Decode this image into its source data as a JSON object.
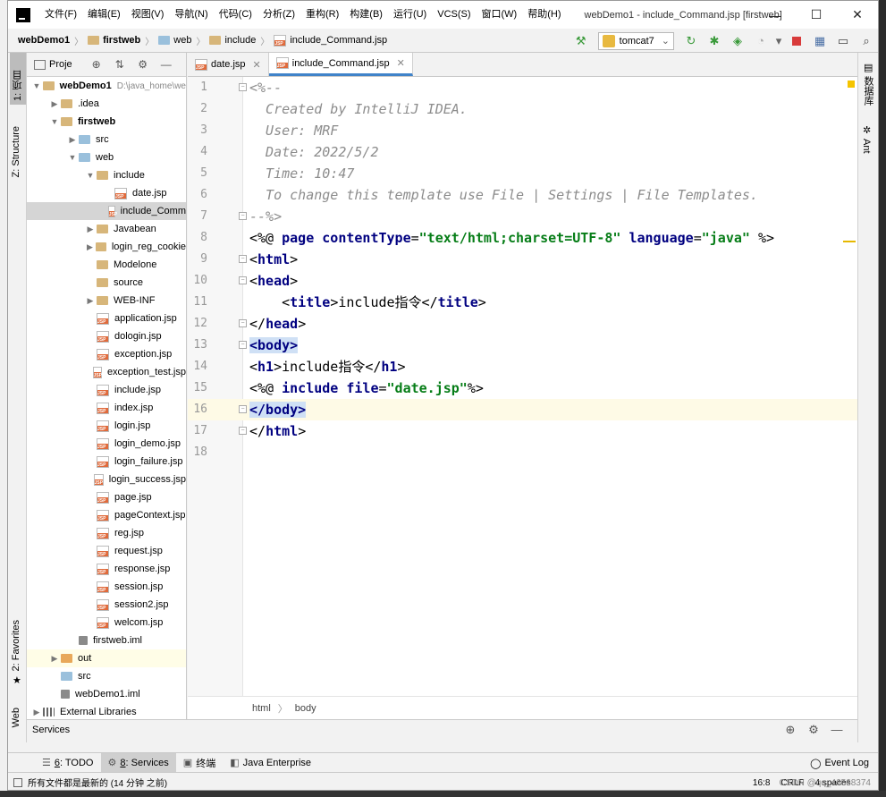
{
  "window": {
    "title": "webDemo1 - include_Command.jsp [firstweb]",
    "minimize": "—",
    "maximize": "☐",
    "close": "✕"
  },
  "menu": [
    "文件(F)",
    "编辑(E)",
    "视图(V)",
    "导航(N)",
    "代码(C)",
    "分析(Z)",
    "重构(R)",
    "构建(B)",
    "运行(U)",
    "VCS(S)",
    "窗口(W)",
    "帮助(H)"
  ],
  "breadcrumb": [
    "webDemo1",
    "firstweb",
    "web",
    "include",
    "include_Command.jsp"
  ],
  "run_config": {
    "label": "tomcat7"
  },
  "left_tabs": {
    "project": "1: 项目",
    "structure": "Z: Structure",
    "favorites": "2: Favorites",
    "web": "Web"
  },
  "right_tabs": {
    "database": "数据库",
    "ant": "Ant"
  },
  "project_panel": {
    "title": "Proje",
    "tree": [
      {
        "label": "webDemo1",
        "hint": "D:\\java_home\\we",
        "type": "folder",
        "depth": 0,
        "expanded": true,
        "bold": true
      },
      {
        "label": ".idea",
        "type": "folder",
        "depth": 1,
        "expanded": false
      },
      {
        "label": "firstweb",
        "type": "folder",
        "depth": 1,
        "expanded": true,
        "bold": true
      },
      {
        "label": "src",
        "type": "folder-blue",
        "depth": 2,
        "expanded": false
      },
      {
        "label": "web",
        "type": "folder-blue",
        "depth": 2,
        "expanded": true
      },
      {
        "label": "include",
        "type": "folder",
        "depth": 3,
        "expanded": true
      },
      {
        "label": "date.jsp",
        "type": "jsp",
        "depth": 4
      },
      {
        "label": "include_Comm",
        "type": "jsp",
        "depth": 4,
        "selected": true
      },
      {
        "label": "Javabean",
        "type": "folder",
        "depth": 3,
        "expanded": false
      },
      {
        "label": "login_reg_cookie",
        "type": "folder",
        "depth": 3,
        "expanded": false
      },
      {
        "label": "Modelone",
        "type": "folder",
        "depth": 3
      },
      {
        "label": "source",
        "type": "folder",
        "depth": 3
      },
      {
        "label": "WEB-INF",
        "type": "folder",
        "depth": 3,
        "expanded": false
      },
      {
        "label": "application.jsp",
        "type": "jsp",
        "depth": 3
      },
      {
        "label": "dologin.jsp",
        "type": "jsp",
        "depth": 3
      },
      {
        "label": "exception.jsp",
        "type": "jsp",
        "depth": 3
      },
      {
        "label": "exception_test.jsp",
        "type": "jsp",
        "depth": 3
      },
      {
        "label": "include.jsp",
        "type": "jsp",
        "depth": 3
      },
      {
        "label": "index.jsp",
        "type": "jsp",
        "depth": 3
      },
      {
        "label": "login.jsp",
        "type": "jsp",
        "depth": 3
      },
      {
        "label": "login_demo.jsp",
        "type": "jsp",
        "depth": 3
      },
      {
        "label": "login_failure.jsp",
        "type": "jsp",
        "depth": 3
      },
      {
        "label": "login_success.jsp",
        "type": "jsp",
        "depth": 3
      },
      {
        "label": "page.jsp",
        "type": "jsp",
        "depth": 3
      },
      {
        "label": "pageContext.jsp",
        "type": "jsp",
        "depth": 3
      },
      {
        "label": "reg.jsp",
        "type": "jsp",
        "depth": 3
      },
      {
        "label": "request.jsp",
        "type": "jsp",
        "depth": 3
      },
      {
        "label": "response.jsp",
        "type": "jsp",
        "depth": 3
      },
      {
        "label": "session.jsp",
        "type": "jsp",
        "depth": 3
      },
      {
        "label": "session2.jsp",
        "type": "jsp",
        "depth": 3
      },
      {
        "label": "welcom.jsp",
        "type": "jsp",
        "depth": 3
      },
      {
        "label": "firstweb.iml",
        "type": "iml",
        "depth": 2
      },
      {
        "label": "out",
        "type": "folder-orange",
        "depth": 1,
        "expanded": false,
        "highlight": true
      },
      {
        "label": "src",
        "type": "folder-blue",
        "depth": 1
      },
      {
        "label": "webDemo1.iml",
        "type": "iml",
        "depth": 1
      },
      {
        "label": "External Libraries",
        "type": "lib",
        "depth": 0,
        "expanded": false
      }
    ]
  },
  "editor": {
    "tabs": [
      {
        "label": "date.jsp",
        "active": false
      },
      {
        "label": "include_Command.jsp",
        "active": true
      }
    ],
    "current_line": 16,
    "lines": [
      [
        {
          "t": "<%--",
          "c": "comment"
        }
      ],
      [
        {
          "t": "  Created by IntelliJ IDEA.",
          "c": "comment"
        }
      ],
      [
        {
          "t": "  User: MRF",
          "c": "comment"
        }
      ],
      [
        {
          "t": "  Date: 2022/5/2",
          "c": "comment"
        }
      ],
      [
        {
          "t": "  Time: 10:47",
          "c": "comment"
        }
      ],
      [
        {
          "t": "  To change this template use File | Settings | File Templates.",
          "c": "comment"
        }
      ],
      [
        {
          "t": "--%>",
          "c": "comment"
        }
      ],
      [
        {
          "t": "<%@ ",
          "c": ""
        },
        {
          "t": "page ",
          "c": "kw"
        },
        {
          "t": "contentType",
          "c": "kw"
        },
        {
          "t": "=",
          "c": ""
        },
        {
          "t": "\"text/html;charset=UTF-8\"",
          "c": "str"
        },
        {
          "t": " ",
          "c": ""
        },
        {
          "t": "language",
          "c": "kw"
        },
        {
          "t": "=",
          "c": ""
        },
        {
          "t": "\"java\"",
          "c": "str"
        },
        {
          "t": " %>",
          "c": ""
        }
      ],
      [
        {
          "t": "<",
          "c": ""
        },
        {
          "t": "html",
          "c": "tag"
        },
        {
          "t": ">",
          "c": ""
        }
      ],
      [
        {
          "t": "<",
          "c": ""
        },
        {
          "t": "head",
          "c": "tag"
        },
        {
          "t": ">",
          "c": ""
        }
      ],
      [
        {
          "t": "    <",
          "c": ""
        },
        {
          "t": "title",
          "c": "tag"
        },
        {
          "t": ">include指令</",
          "c": ""
        },
        {
          "t": "title",
          "c": "tag"
        },
        {
          "t": ">",
          "c": ""
        }
      ],
      [
        {
          "t": "</",
          "c": ""
        },
        {
          "t": "head",
          "c": "tag"
        },
        {
          "t": ">",
          "c": ""
        }
      ],
      [
        {
          "t": "<body>",
          "c": "tag hl"
        }
      ],
      [
        {
          "t": "<",
          "c": ""
        },
        {
          "t": "h1",
          "c": "tag"
        },
        {
          "t": ">include指令</",
          "c": ""
        },
        {
          "t": "h1",
          "c": "tag"
        },
        {
          "t": ">",
          "c": ""
        }
      ],
      [
        {
          "t": "<%@ ",
          "c": ""
        },
        {
          "t": "include ",
          "c": "kw"
        },
        {
          "t": "file",
          "c": "kw"
        },
        {
          "t": "=",
          "c": ""
        },
        {
          "t": "\"date.jsp\"",
          "c": "str"
        },
        {
          "t": "%>",
          "c": ""
        }
      ],
      [
        {
          "t": "</body>",
          "c": "tag hl"
        }
      ],
      [
        {
          "t": "</",
          "c": ""
        },
        {
          "t": "html",
          "c": "tag"
        },
        {
          "t": ">",
          "c": ""
        }
      ],
      [
        {
          "t": "",
          "c": ""
        }
      ]
    ],
    "fold_lines": [
      1,
      7,
      9,
      10,
      12,
      13,
      16,
      17
    ],
    "breadcrumb": [
      "html",
      "body"
    ]
  },
  "services": {
    "title": "Services"
  },
  "bottom_tools": [
    {
      "num": "6",
      "label": ": TODO",
      "icon": "todo-icon",
      "active": false
    },
    {
      "num": "8",
      "label": ": Services",
      "icon": "services-icon",
      "active": true
    },
    {
      "num": "",
      "label": "终端",
      "icon": "terminal-icon",
      "active": false
    },
    {
      "num": "",
      "label": "Java Enterprise",
      "icon": "java-enterprise-icon",
      "active": false
    }
  ],
  "event_log": "Event Log",
  "status": {
    "message": "所有文件都是最新的 (14 分钟 之前)",
    "position": "16:8",
    "line_sep": "CRLF",
    "indent": "4 spaces",
    "watermark": "CSDN @qq_46568374"
  }
}
